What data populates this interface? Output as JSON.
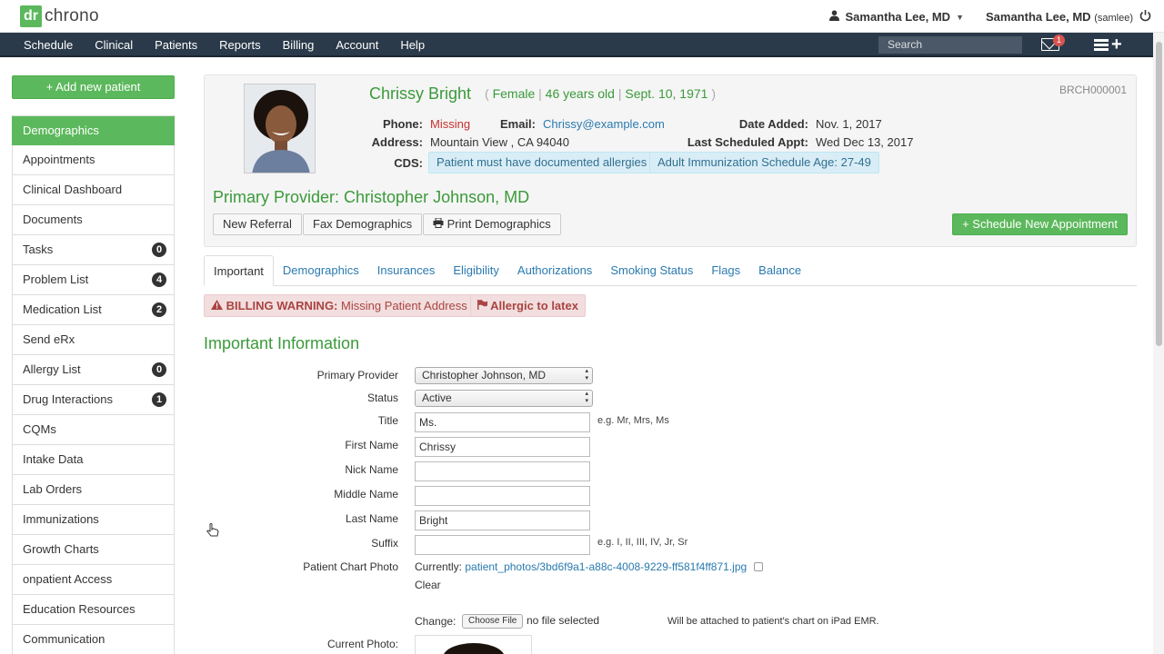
{
  "app": {
    "logo_box": "dr",
    "logo_text": "chrono",
    "user_menu": "Samantha Lee, MD",
    "user_right": "Samantha Lee, MD",
    "user_right_handle": "(samlee)"
  },
  "nav": {
    "items": [
      "Schedule",
      "Clinical",
      "Patients",
      "Reports",
      "Billing",
      "Account",
      "Help"
    ],
    "search_placeholder": "Search",
    "mail_count": "1"
  },
  "sidebar": {
    "add_button": "+ Add new patient",
    "items": [
      {
        "label": "Demographics",
        "badge": ""
      },
      {
        "label": "Appointments",
        "badge": ""
      },
      {
        "label": "Clinical Dashboard",
        "badge": ""
      },
      {
        "label": "Documents",
        "badge": ""
      },
      {
        "label": "Tasks",
        "badge": "0"
      },
      {
        "label": "Problem List",
        "badge": "4"
      },
      {
        "label": "Medication List",
        "badge": "2"
      },
      {
        "label": "Send eRx",
        "badge": ""
      },
      {
        "label": "Allergy List",
        "badge": "0"
      },
      {
        "label": "Drug Interactions",
        "badge": "1"
      },
      {
        "label": "CQMs",
        "badge": ""
      },
      {
        "label": "Intake Data",
        "badge": ""
      },
      {
        "label": "Lab Orders",
        "badge": ""
      },
      {
        "label": "Immunizations",
        "badge": ""
      },
      {
        "label": "Growth Charts",
        "badge": ""
      },
      {
        "label": "onpatient Access",
        "badge": ""
      },
      {
        "label": "Education Resources",
        "badge": ""
      },
      {
        "label": "Communication",
        "badge": ""
      }
    ]
  },
  "patient": {
    "name": "Chrissy Bright",
    "gender": "Female",
    "age": "46 years old",
    "dob": "Sept. 10, 1971",
    "id": "BRCH000001",
    "phone_label": "Phone:",
    "phone_value": "Missing",
    "email_label": "Email:",
    "email_value": "Chrissy@example.com",
    "date_added_label": "Date Added:",
    "date_added_value": "Nov. 1, 2017",
    "address_label": "Address:",
    "address_value": "Mountain View , CA 94040",
    "last_appt_label": "Last Scheduled Appt:",
    "last_appt_value": "Wed Dec 13, 2017",
    "cds_label": "CDS:",
    "cds_tags": [
      "Patient must have documented allergies",
      "Adult Immunization Schedule Age: 27-49"
    ],
    "primary_provider": "Primary Provider: Christopher Johnson, MD",
    "buttons": {
      "new_referral": "New Referral",
      "fax": "Fax Demographics",
      "print": "Print Demographics",
      "schedule": "+ Schedule New Appointment"
    }
  },
  "tabs": [
    "Important",
    "Demographics",
    "Insurances",
    "Eligibility",
    "Authorizations",
    "Smoking Status",
    "Flags",
    "Balance"
  ],
  "warnings": {
    "billing_bold": "BILLING WARNING:",
    "billing_text": "Missing Patient Address",
    "allergy": "Allergic to latex"
  },
  "section_title": "Important Information",
  "form": {
    "primary_provider_label": "Primary Provider",
    "primary_provider_value": "Christopher Johnson, MD",
    "status_label": "Status",
    "status_value": "Active",
    "title_label": "Title",
    "title_value": "Ms.",
    "title_hint": "e.g. Mr, Mrs, Ms",
    "first_name_label": "First Name",
    "first_name_value": "Chrissy",
    "nick_name_label": "Nick Name",
    "nick_name_value": "",
    "middle_name_label": "Middle Name",
    "middle_name_value": "",
    "last_name_label": "Last Name",
    "last_name_value": "Bright",
    "suffix_label": "Suffix",
    "suffix_value": "",
    "suffix_hint": "e.g. I, II, III, IV, Jr, Sr",
    "photo_label": "Patient Chart Photo",
    "currently_label": "Currently:",
    "photo_path": "patient_photos/3bd6f9a1-a88c-4008-9229-ff581f4ff871.jpg",
    "clear_label": "Clear",
    "change_label": "Change:",
    "choose_file": "Choose File",
    "no_file": "no file selected",
    "ipad_note": "Will be attached to patient's chart on iPad EMR.",
    "current_photo_label": "Current Photo:"
  },
  "colors": {
    "brand_green": "#5cb85c",
    "nav_bg": "#2b3a4a",
    "link_blue": "#2a7ab0",
    "title_green": "#3a9a3a"
  }
}
